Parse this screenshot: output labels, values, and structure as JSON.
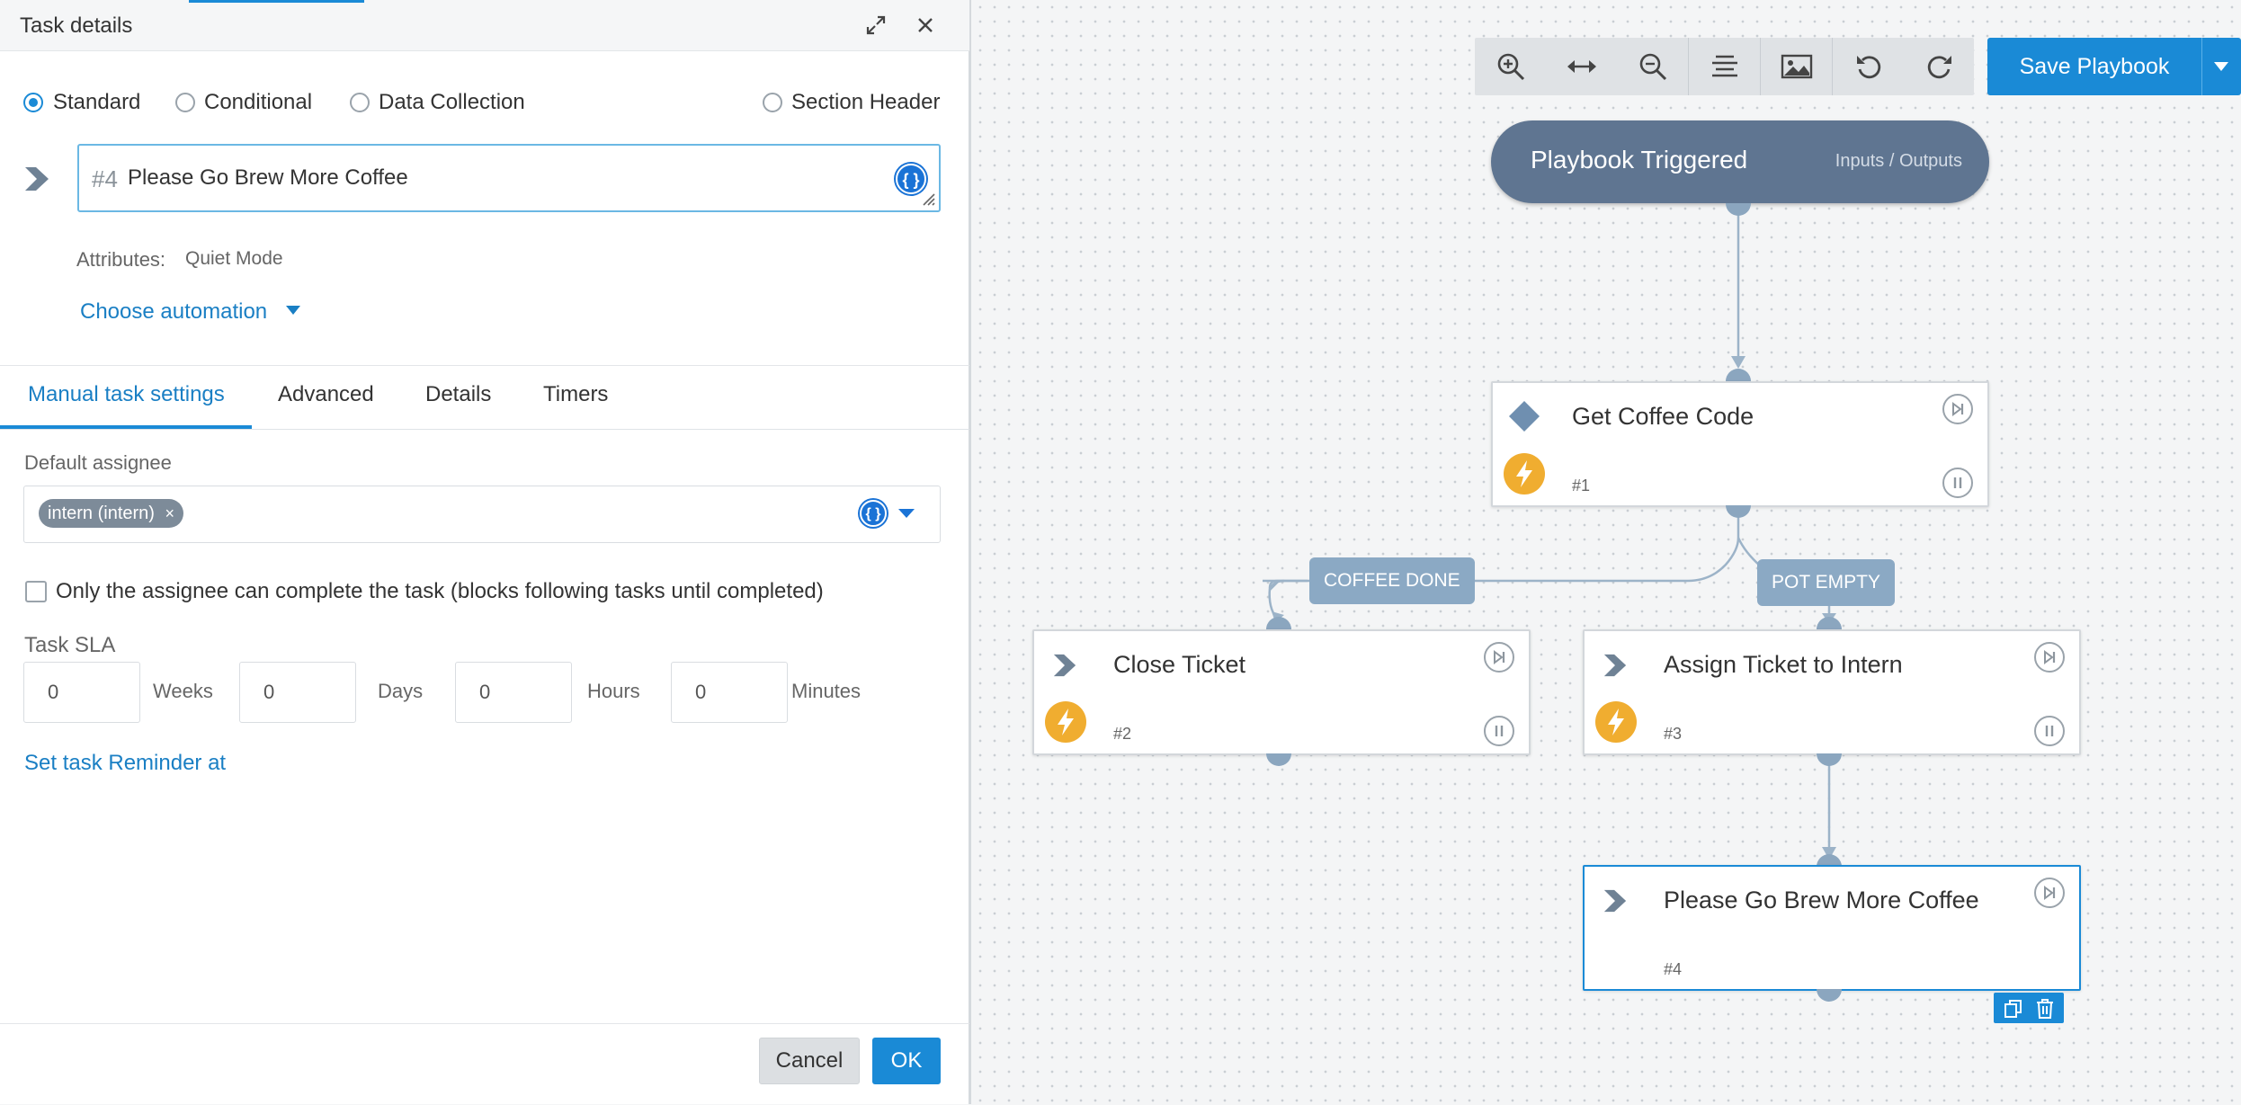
{
  "panel": {
    "title": "Task details",
    "task_types": [
      "Standard",
      "Conditional",
      "Data Collection",
      "Section Header"
    ],
    "selected_type": "Standard",
    "task_number": "#4",
    "task_name": "Please Go Brew More Coffee",
    "attributes_label": "Attributes:",
    "attributes_value": "Quiet Mode",
    "choose_automation": "Choose automation",
    "tabs": [
      "Manual task settings",
      "Advanced",
      "Details",
      "Timers"
    ],
    "active_tab": "Manual task settings",
    "default_assignee_label": "Default assignee",
    "assignee_chip": "intern (intern)",
    "chip_remove": "×",
    "only_assignee_label": "Only the assignee can complete the task (blocks following tasks until completed)",
    "task_sla_label": "Task SLA",
    "sla": [
      {
        "value": "0",
        "unit": "Weeks"
      },
      {
        "value": "0",
        "unit": "Days"
      },
      {
        "value": "0",
        "unit": "Hours"
      },
      {
        "value": "0",
        "unit": "Minutes"
      }
    ],
    "reminder_link": "Set task Reminder at",
    "cancel": "Cancel",
    "ok": "OK",
    "brace_glyph": "{ }"
  },
  "canvas": {
    "toolbar_icons": [
      "zoom-in-icon",
      "fit-width-icon",
      "zoom-out-icon",
      "align-icon",
      "image-icon",
      "undo-icon",
      "redo-icon"
    ],
    "save_button": "Save Playbook",
    "trigger": {
      "title": "Playbook Triggered",
      "io_link": "Inputs / Outputs"
    },
    "nodes": [
      {
        "title": "Get Coffee Code",
        "number": "#1"
      },
      {
        "title": "Close Ticket",
        "number": "#2"
      },
      {
        "title": "Assign Ticket to Intern",
        "number": "#3"
      },
      {
        "title": "Please Go Brew More Coffee",
        "number": "#4"
      }
    ],
    "conditions": [
      "COFFEE DONE",
      "POT EMPTY"
    ],
    "colors": {
      "accent": "#1a8ad6",
      "trigger": "#5f7591",
      "condition": "#8ba9c4",
      "bolt": "#f0ad30"
    }
  }
}
